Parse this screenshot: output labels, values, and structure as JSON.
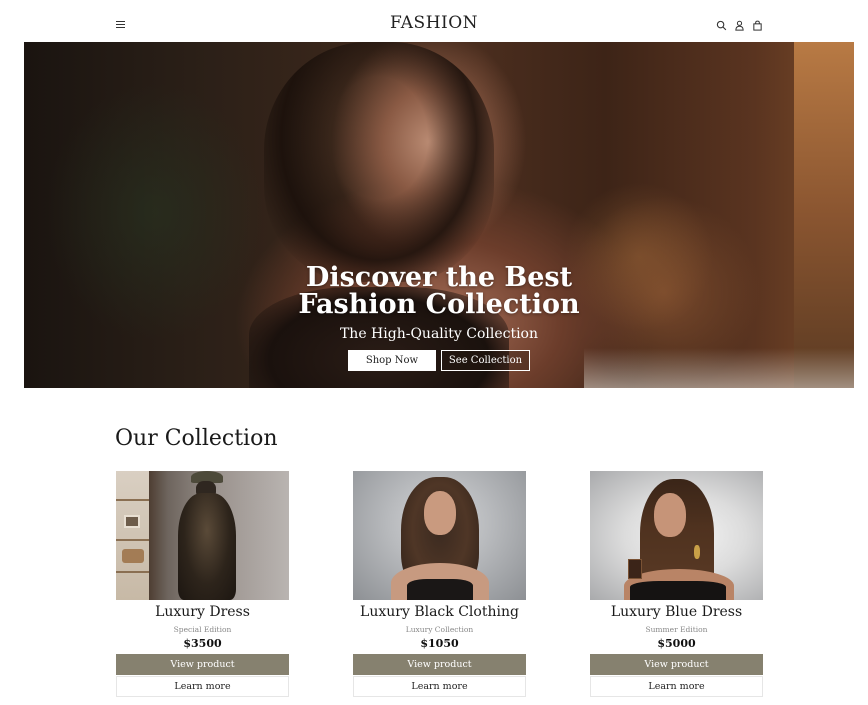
{
  "header": {
    "brand": "FASHION",
    "menu_icon": "hamburger-menu-icon",
    "icons": [
      "search-icon",
      "user-icon",
      "bag-icon"
    ]
  },
  "hero": {
    "title_line1": "Discover the Best",
    "title_line2": "Fashion Collection",
    "subtitle": "The High-Quality Collection",
    "shop_now": "Shop Now",
    "see_collection": "See Collection"
  },
  "collection": {
    "title": "Our Collection",
    "products": [
      {
        "name": "Luxury Dress",
        "edition": "Special Edition",
        "price": "$3500",
        "view": "View product",
        "learn": "Learn more"
      },
      {
        "name": "Luxury Black Clothing",
        "edition": "Luxury Collection",
        "price": "$1050",
        "view": "View product",
        "learn": "Learn more"
      },
      {
        "name": "Luxury Blue Dress",
        "edition": "Summer Edition",
        "price": "$5000",
        "view": "View product",
        "learn": "Learn more"
      }
    ]
  },
  "colors": {
    "button_accent": "#86816f",
    "text_dark": "#1a1a1a",
    "muted": "#888888"
  }
}
